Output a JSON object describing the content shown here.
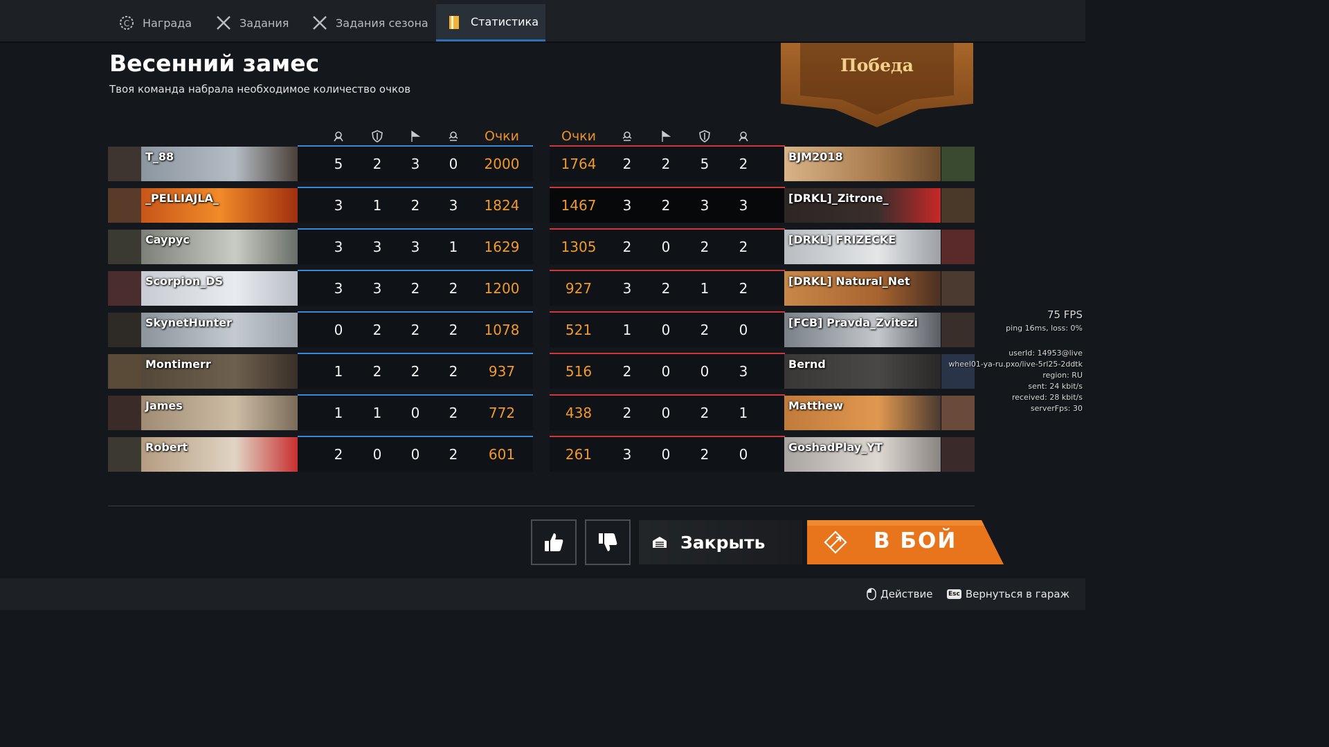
{
  "tabs": [
    {
      "label": "Награда",
      "icon": "reward-gear-icon",
      "active": false
    },
    {
      "label": "Задания",
      "icon": "crossed-swords-icon",
      "active": false
    },
    {
      "label": "Задания сезона",
      "icon": "crossed-swords-icon",
      "active": false
    },
    {
      "label": "Статистика",
      "icon": "stats-book-icon",
      "active": true
    }
  ],
  "title": "Весенний замес",
  "subtitle": "Твоя команда набрала необходимое количество очков",
  "result": "Победа",
  "columns": {
    "left": [
      "kills-icon",
      "shield-icon",
      "flag-icon",
      "assists-icon"
    ],
    "right": [
      "assists-icon",
      "flag-icon",
      "shield-icon",
      "kills-icon"
    ],
    "score_label": "Очки"
  },
  "teams": {
    "ally": [
      {
        "name": "T_88",
        "stats": [
          5,
          2,
          3,
          0
        ],
        "score": 2000
      },
      {
        "name": "_PELLIAJLA_",
        "stats": [
          3,
          1,
          2,
          3
        ],
        "score": 1824
      },
      {
        "name": "Caypyc",
        "stats": [
          3,
          3,
          3,
          1
        ],
        "score": 1629
      },
      {
        "name": "Scorpion_DS",
        "stats": [
          3,
          3,
          2,
          2
        ],
        "score": 1200
      },
      {
        "name": "SkynetHunter",
        "stats": [
          0,
          2,
          2,
          2
        ],
        "score": 1078
      },
      {
        "name": "Montimerr",
        "stats": [
          1,
          2,
          2,
          2
        ],
        "score": 937
      },
      {
        "name": "James",
        "stats": [
          1,
          1,
          0,
          2
        ],
        "score": 772
      },
      {
        "name": "Robert",
        "stats": [
          2,
          0,
          0,
          2
        ],
        "score": 601
      }
    ],
    "enemy": [
      {
        "name": "BJM2018",
        "stats": [
          2,
          2,
          5,
          2
        ],
        "score": 1764
      },
      {
        "name": "[DRKL]_Zitrone_",
        "stats": [
          3,
          2,
          3,
          3
        ],
        "score": 1467,
        "highlight": true
      },
      {
        "name": "[DRKL] FRIZECKE",
        "stats": [
          2,
          0,
          2,
          2
        ],
        "score": 1305
      },
      {
        "name": "[DRKL] Natural_Net",
        "stats": [
          3,
          2,
          1,
          2
        ],
        "score": 927
      },
      {
        "name": "[FCB] Pravda_Zvitezi",
        "stats": [
          1,
          0,
          2,
          0
        ],
        "score": 521
      },
      {
        "name": "Bernd",
        "stats": [
          2,
          0,
          0,
          3
        ],
        "score": 516
      },
      {
        "name": "Matthew",
        "stats": [
          2,
          0,
          2,
          1
        ],
        "score": 438
      },
      {
        "name": "GoshadPlay_YT",
        "stats": [
          3,
          0,
          2,
          0
        ],
        "score": 261
      }
    ]
  },
  "buttons": {
    "like": "thumbs-up-icon",
    "dislike": "thumbs-down-icon",
    "close": "Закрыть",
    "battle": "В БОЙ"
  },
  "hints": {
    "action": "Действие",
    "back": "Вернуться в гараж",
    "esc_key": "Esc"
  },
  "debug": {
    "fps": "75 FPS",
    "ping": "ping 16ms, loss:  0%",
    "user": "userId: 14953@live",
    "server": "wheel01-ya-ru.pxo/live-5rl25-2ddtk",
    "region": "region: RU",
    "sent": "sent: 24 kbit/s",
    "received": "received: 28 kbit/s",
    "serverfps": "serverFps: 30"
  },
  "colors": {
    "ally_line": "#3d88d8",
    "enemy_line": "#d03838",
    "score": "#f09a2e",
    "battle_button": "#e8751c"
  }
}
